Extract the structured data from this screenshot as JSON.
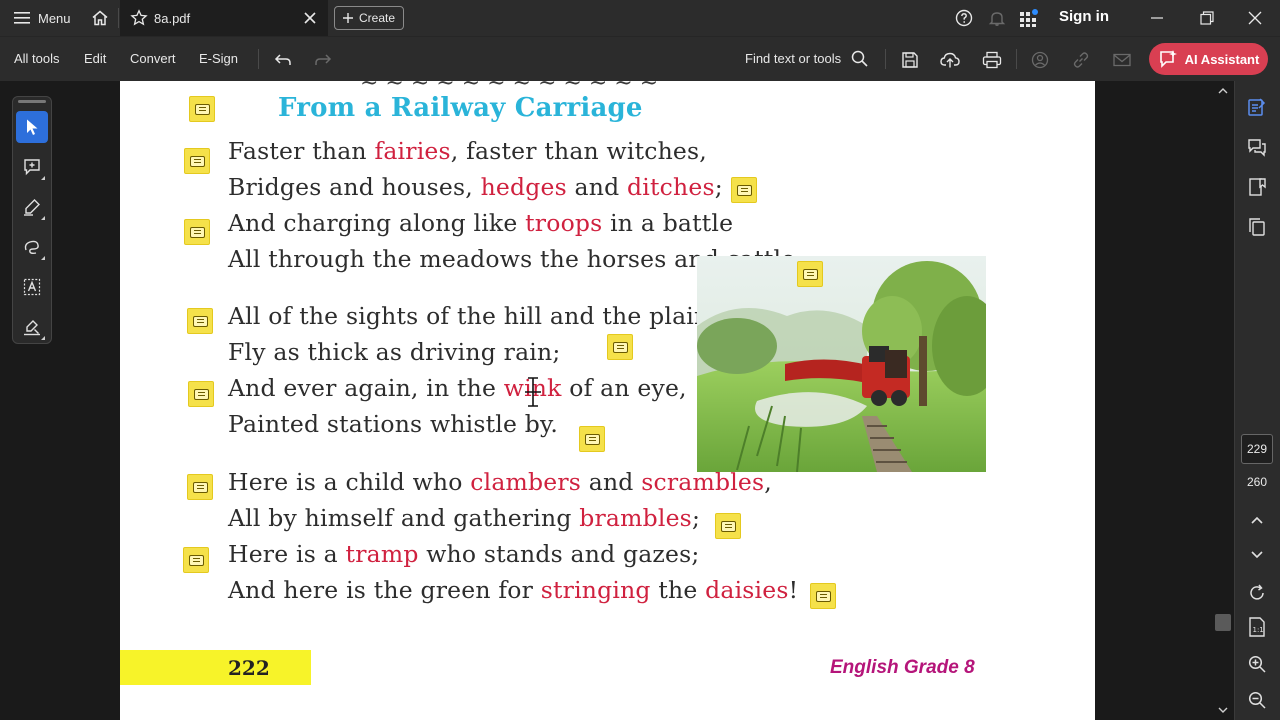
{
  "titlebar": {
    "menu_label": "Menu",
    "tab_title": "8a.pdf",
    "create_label": "Create",
    "sign_in_label": "Sign in"
  },
  "toolbar": {
    "all_tools": "All tools",
    "edit": "Edit",
    "convert": "Convert",
    "esign": "E-Sign",
    "find_label": "Find text or tools",
    "ai_assistant": "AI Assistant"
  },
  "document": {
    "cut_line": "~ ~ ~ ~ ~ ~ ~ ~ ~ ~ ~ ~",
    "poem_title": "From a Railway Carriage",
    "page_number": "222",
    "footer": "English Grade  8"
  },
  "navigation": {
    "current_page": "229",
    "total_pages": "260"
  },
  "colors": {
    "accent_red": "#d93f52",
    "title_cyan": "#2ab4d9",
    "highlight_word": "#d0213f",
    "sticky_note": "#f5e14a",
    "page_bar_yellow": "#f7f329",
    "footer_magenta": "#b5157a",
    "active_tool_blue": "#2d6fdb"
  }
}
